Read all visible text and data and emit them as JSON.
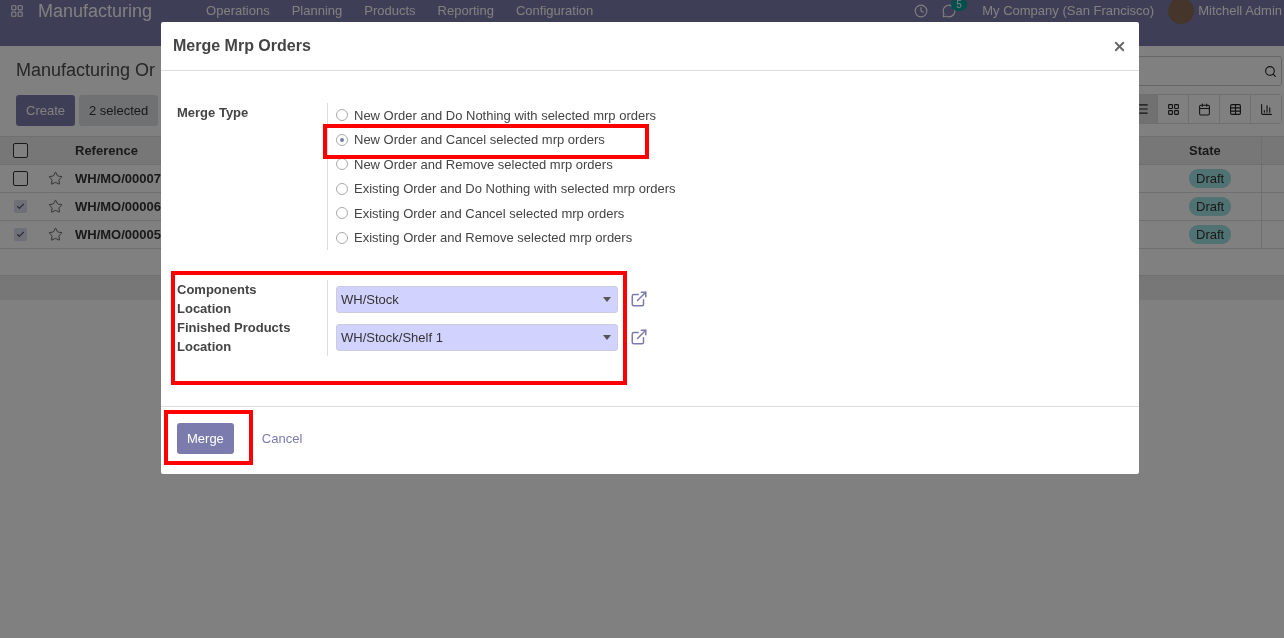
{
  "navbar": {
    "app_name": "Manufacturing",
    "menu": [
      "Operations",
      "Planning",
      "Products",
      "Reporting",
      "Configuration"
    ],
    "activity_count": "5",
    "company": "My Company (San Francisco)",
    "user": "Mitchell Admin"
  },
  "breadcrumb": "Manufacturing Or",
  "actions": {
    "create": "Create",
    "selection": "2 selected"
  },
  "view_switcher": [
    {
      "kind": "list",
      "selected": true
    },
    {
      "kind": "kanban",
      "selected": false
    },
    {
      "kind": "calendar",
      "selected": false
    },
    {
      "kind": "pivot",
      "selected": false
    },
    {
      "kind": "graph",
      "selected": false
    }
  ],
  "table": {
    "header_checked": false,
    "columns": [
      "Reference",
      "State"
    ],
    "rows": [
      {
        "reference": "WH/MO/00007",
        "state": "Draft",
        "checked": false
      },
      {
        "reference": "WH/MO/00006",
        "state": "Draft",
        "checked": true
      },
      {
        "reference": "WH/MO/00005",
        "state": "Draft",
        "checked": true
      }
    ]
  },
  "dialog": {
    "title": "Merge Mrp Orders",
    "merge_type": {
      "label": "Merge Type",
      "options": [
        {
          "label": "New Order and Do Nothing with selected mrp orders",
          "selected": false
        },
        {
          "label": "New Order and Cancel selected mrp orders",
          "selected": true
        },
        {
          "label": "New Order and Remove selected mrp orders",
          "selected": false
        },
        {
          "label": "Existing Order and Do Nothing with selected mrp orders",
          "selected": false
        },
        {
          "label": "Existing Order and Cancel selected mrp orders",
          "selected": false
        },
        {
          "label": "Existing Order and Remove selected mrp orders",
          "selected": false
        }
      ]
    },
    "fields": [
      {
        "label": "Components Location",
        "value": "WH/Stock"
      },
      {
        "label": "Finished Products Location",
        "value": "WH/Stock/Shelf 1"
      }
    ],
    "primary_button": "Merge",
    "secondary_button": "Cancel"
  }
}
